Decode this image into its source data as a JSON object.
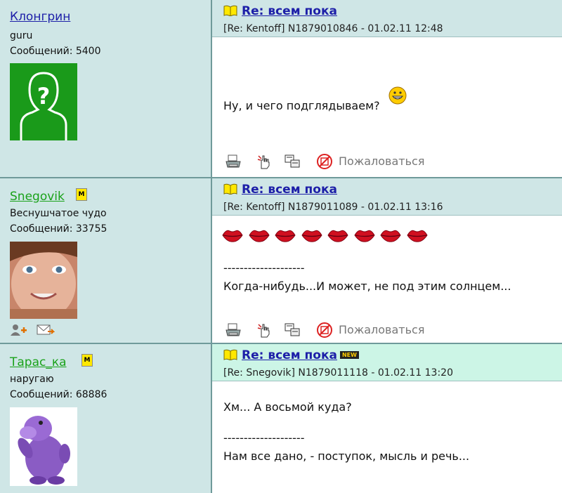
{
  "posts": [
    {
      "user": {
        "name": "Клонгрин",
        "rank": "guru",
        "count": "Сообщений: 5400"
      },
      "title": "Re: всем пока",
      "meta": "[Re: Kentoff]  N1879010846 - 01.02.11 12:48",
      "lines": [
        "Ну, и чего подглядываем?"
      ],
      "actions": {
        "print": "printer-icon",
        "reply": "hand-icon",
        "split": "compare-icon",
        "complain_label": "Пожаловаться"
      }
    },
    {
      "user": {
        "name": "Snegovik",
        "moderator_badge": "M",
        "rank": "Веснушчатое чудо",
        "count": "Сообщений: 33755"
      },
      "title": "Re: всем пока",
      "meta": "[Re: Kentoff]  N1879011089 - 01.02.11 13:16",
      "lips_count": 8,
      "lines": [
        "--------------------",
        "Когда-нибудь...И может, не под этим солнцем..."
      ],
      "actions": {
        "complain_label": "Пожаловаться"
      },
      "user_actions": [
        "add-friend-icon",
        "send-message-icon"
      ]
    },
    {
      "user": {
        "name": "Тарас_ка",
        "moderator_badge": "M",
        "rank": "наругаю",
        "count": "Сообщений: 68886"
      },
      "title": "Re: всем пока",
      "new_badge": "NEW",
      "meta": "[Re: Snegovik]  N1879011118 - 01.02.11 13:20",
      "lines": [
        "Хм... А восьмой куда?",
        "--------------------",
        "Нам все дано, - поступок, мысль и речь..."
      ]
    }
  ],
  "colors": {
    "panel": "#cfe6e6",
    "link": "#1d1fa8",
    "username_green": "#1aa21a",
    "new_header": "#ccf5e6"
  }
}
